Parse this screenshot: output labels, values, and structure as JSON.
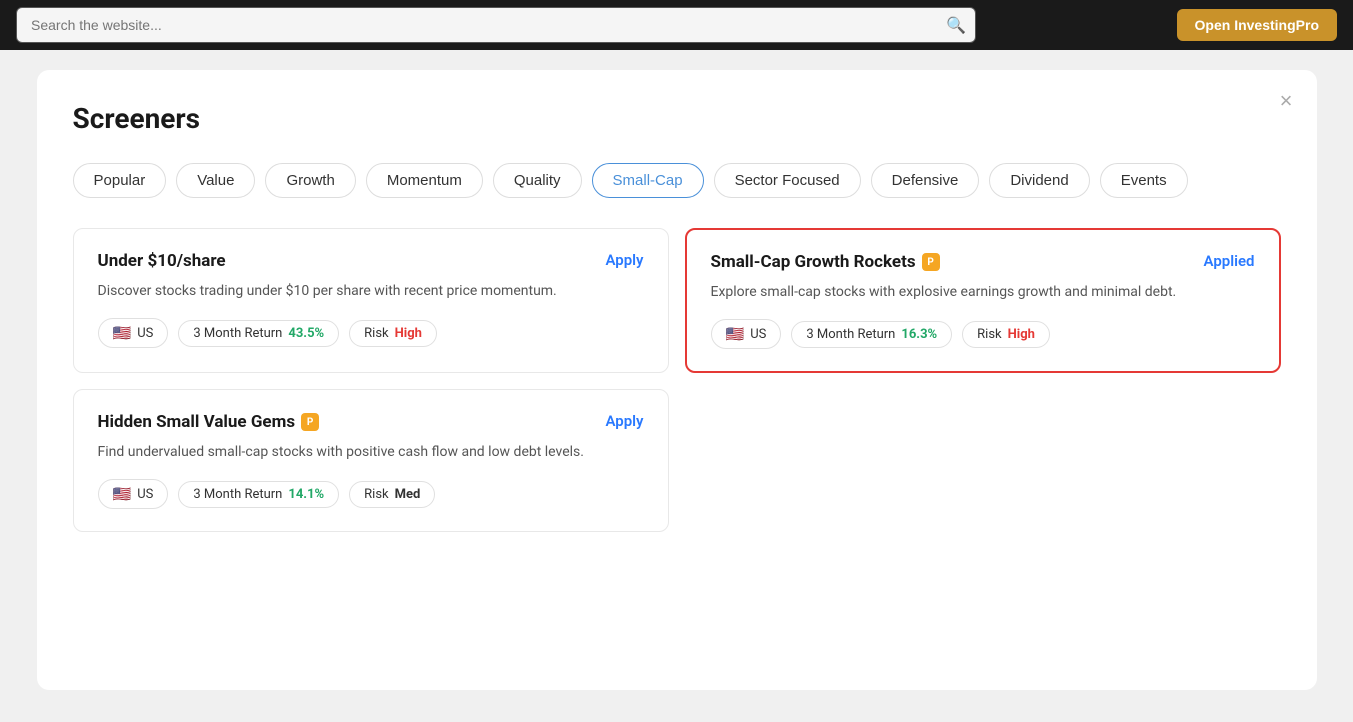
{
  "topbar": {
    "search_placeholder": "Search the website...",
    "open_btn_label": "Open InvestingPro"
  },
  "dialog": {
    "title": "Screeners",
    "close_label": "×"
  },
  "filter_tabs": [
    {
      "id": "popular",
      "label": "Popular",
      "active": false
    },
    {
      "id": "value",
      "label": "Value",
      "active": false
    },
    {
      "id": "growth",
      "label": "Growth",
      "active": false
    },
    {
      "id": "momentum",
      "label": "Momentum",
      "active": false
    },
    {
      "id": "quality",
      "label": "Quality",
      "active": false
    },
    {
      "id": "small-cap",
      "label": "Small-Cap",
      "active": true
    },
    {
      "id": "sector-focused",
      "label": "Sector Focused",
      "active": false
    },
    {
      "id": "defensive",
      "label": "Defensive",
      "active": false
    },
    {
      "id": "dividend",
      "label": "Dividend",
      "active": false
    },
    {
      "id": "events",
      "label": "Events",
      "active": false
    }
  ],
  "cards": [
    {
      "id": "under-10",
      "title": "Under $10/share",
      "pro": false,
      "action_label": "Apply",
      "highlighted": false,
      "description": "Discover stocks trading under $10 per share with recent price momentum.",
      "tags": [
        {
          "type": "region",
          "flag": "🇺🇸",
          "label": "US"
        },
        {
          "type": "return",
          "prefix": "3 Month Return",
          "value": "43.5%",
          "color": "positive"
        },
        {
          "type": "risk",
          "prefix": "Risk",
          "value": "High",
          "color": "high"
        }
      ]
    },
    {
      "id": "small-cap-rockets",
      "title": "Small-Cap Growth Rockets",
      "pro": true,
      "action_label": "Applied",
      "highlighted": true,
      "description": "Explore small-cap stocks with explosive earnings growth and minimal debt.",
      "tags": [
        {
          "type": "region",
          "flag": "🇺🇸",
          "label": "US"
        },
        {
          "type": "return",
          "prefix": "3 Month Return",
          "value": "16.3%",
          "color": "positive"
        },
        {
          "type": "risk",
          "prefix": "Risk",
          "value": "High",
          "color": "high"
        }
      ]
    },
    {
      "id": "hidden-gems",
      "title": "Hidden Small Value Gems",
      "pro": true,
      "action_label": "Apply",
      "highlighted": false,
      "description": "Find undervalued small-cap stocks with positive cash flow and low debt levels.",
      "tags": [
        {
          "type": "region",
          "flag": "🇺🇸",
          "label": "US"
        },
        {
          "type": "return",
          "prefix": "3 Month Return",
          "value": "14.1%",
          "color": "positive"
        },
        {
          "type": "risk",
          "prefix": "Risk",
          "value": "Med",
          "color": "med"
        }
      ]
    }
  ]
}
